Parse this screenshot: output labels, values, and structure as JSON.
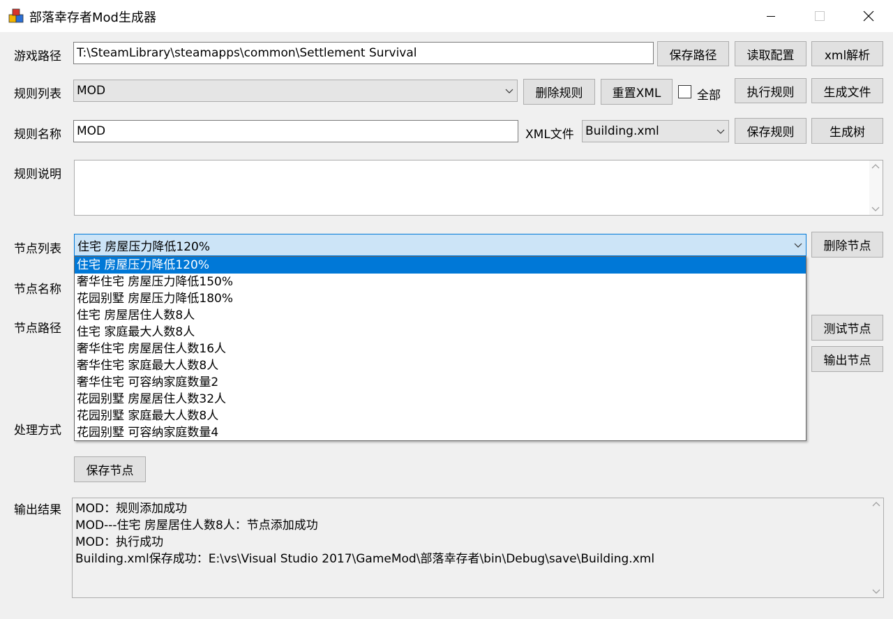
{
  "window": {
    "title": "部落幸存者Mod生成器"
  },
  "labels": {
    "game_path": "游戏路径",
    "rule_list": "规则列表",
    "rule_name": "规则名称",
    "rule_desc": "规则说明",
    "node_list": "节点列表",
    "node_name": "节点名称",
    "node_path": "节点路径",
    "process_method": "处理方式",
    "output_result": "输出结果",
    "xml_file": "XML文件",
    "all": "全部"
  },
  "fields": {
    "game_path_value": "T:\\SteamLibrary\\steamapps\\common\\Settlement Survival",
    "rule_list_value": "MOD",
    "rule_name_value": "MOD",
    "xml_file_value": "Building.xml",
    "rule_desc_value": "",
    "node_list_value": "住宅 房屋压力降低120%"
  },
  "buttons": {
    "save_path": "保存路径",
    "read_config": "读取配置",
    "xml_parse": "xml解析",
    "delete_rule": "删除规则",
    "reset_xml": "重置XML",
    "execute_rule": "执行规则",
    "generate_file": "生成文件",
    "save_rule": "保存规则",
    "generate_tree": "生成树",
    "delete_node": "删除节点",
    "test_node": "测试节点",
    "output_node": "输出节点",
    "save_node": "保存节点"
  },
  "checkbox_all_checked": false,
  "node_dropdown": {
    "selected_index": 0,
    "items": [
      "住宅 房屋压力降低120%",
      "奢华住宅 房屋压力降低150%",
      "花园别墅 房屋压力降低180%",
      "住宅 房屋居住人数8人",
      "住宅 家庭最大人数8人",
      "奢华住宅 房屋居住人数16人",
      "奢华住宅 家庭最大人数8人",
      "奢华住宅 可容纳家庭数量2",
      "花园别墅 房屋居住人数32人",
      "花园别墅 家庭最大人数8人",
      "花园别墅 可容纳家庭数量4"
    ]
  },
  "output": {
    "lines": [
      "MOD：规则添加成功",
      "MOD---住宅 房屋居住人数8人：节点添加成功",
      "MOD：执行成功",
      "Building.xml保存成功：E:\\vs\\Visual Studio 2017\\GameMod\\部落幸存者\\bin\\Debug\\save\\Building.xml"
    ]
  },
  "colors": {
    "selection": "#0078d7",
    "combo_highlight": "#cce4f7",
    "window_bg": "#f0f0f0"
  },
  "icons": {
    "app": "app-icon",
    "minimize": "minimize-icon",
    "maximize": "maximize-icon",
    "close": "close-icon",
    "dropdown": "chevron-down-icon"
  }
}
